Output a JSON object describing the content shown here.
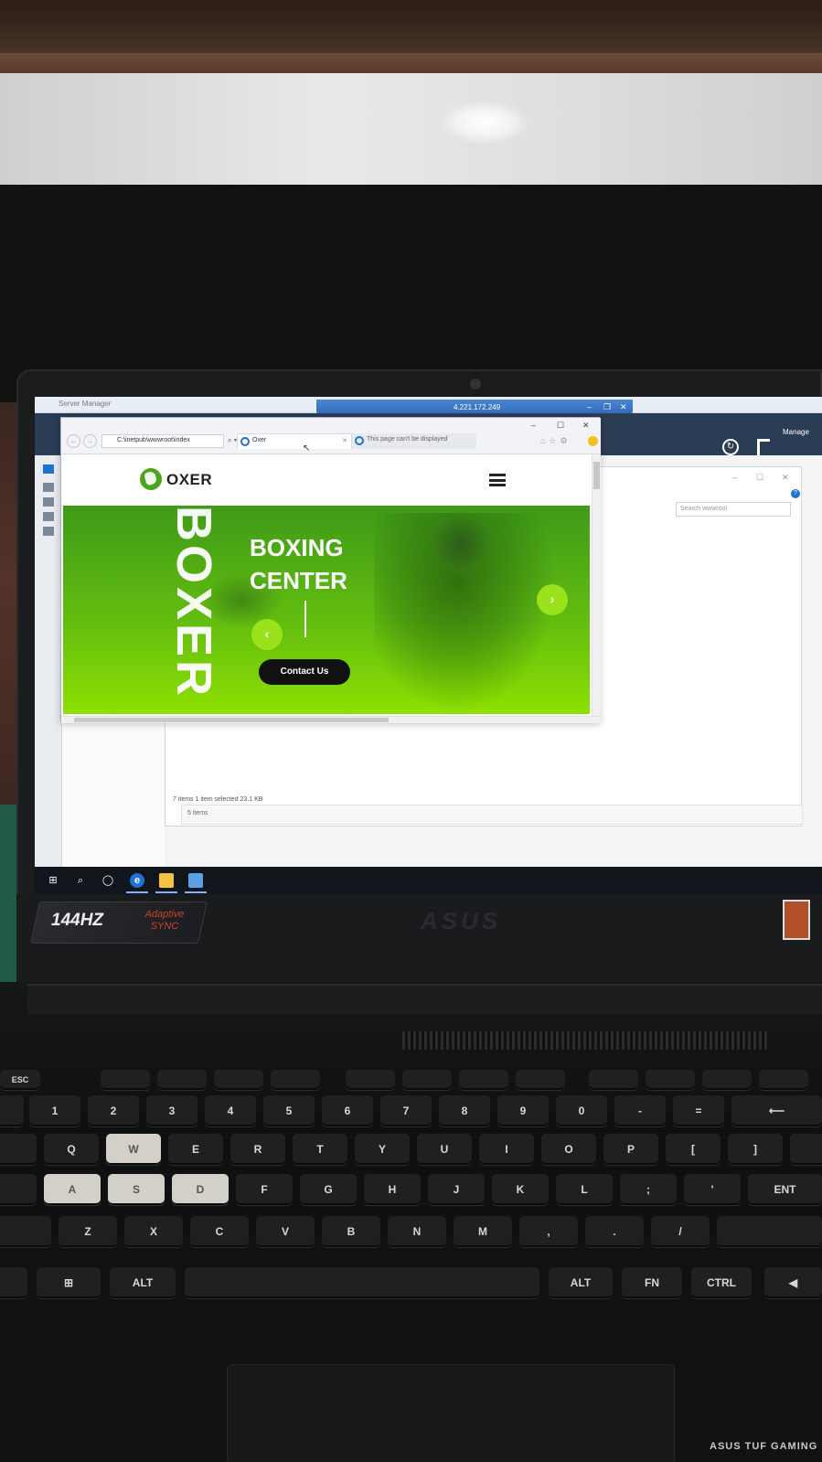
{
  "server_manager": {
    "title": "Server Manager",
    "rdp_ip": "4.221.172.249",
    "manage_label": "Manage",
    "explorer": {
      "search_placeholder": "Search wwwroot",
      "status": "7 items    1 item selected  23.1 KB",
      "lower_items": "5 items"
    }
  },
  "browser": {
    "address": "C:\\inetpub\\wwwroot\\index",
    "tabs": [
      {
        "label": "Oxer",
        "active": true
      },
      {
        "label": "This page can't be displayed",
        "active": false
      }
    ]
  },
  "site": {
    "logo_text": "OXER",
    "hero_vertical_word": "BOXER",
    "hero_title_line1": "BOXING",
    "hero_title_line2": "CENTER",
    "cta_label": "Contact Us",
    "prev_label": "‹",
    "next_label": "›",
    "brand_color": "#62bd10"
  },
  "laptop": {
    "refresh_badge": "144HZ",
    "adaptive_line1": "Adaptive",
    "adaptive_line2": "SYNC",
    "brand": "ASUS",
    "series": "ASUS TUF GAMING"
  },
  "keyboard": {
    "row_num": [
      "ESC",
      "1",
      "2",
      "3",
      "4",
      "5",
      "6",
      "7",
      "8",
      "9",
      "0",
      "-",
      "="
    ],
    "row_q": [
      "Q",
      "W",
      "E",
      "R",
      "T",
      "Y",
      "U",
      "I",
      "O",
      "P",
      "[",
      "]"
    ],
    "row_a": [
      "A",
      "S",
      "D",
      "F",
      "G",
      "H",
      "J",
      "K",
      "L",
      ";",
      "'",
      "ENT"
    ],
    "row_z": [
      "Z",
      "X",
      "C",
      "V",
      "B",
      "N",
      "M",
      ",",
      ".",
      "/"
    ],
    "row_bottom": [
      "ALT",
      "ALT",
      "FN",
      "CTRL"
    ]
  }
}
